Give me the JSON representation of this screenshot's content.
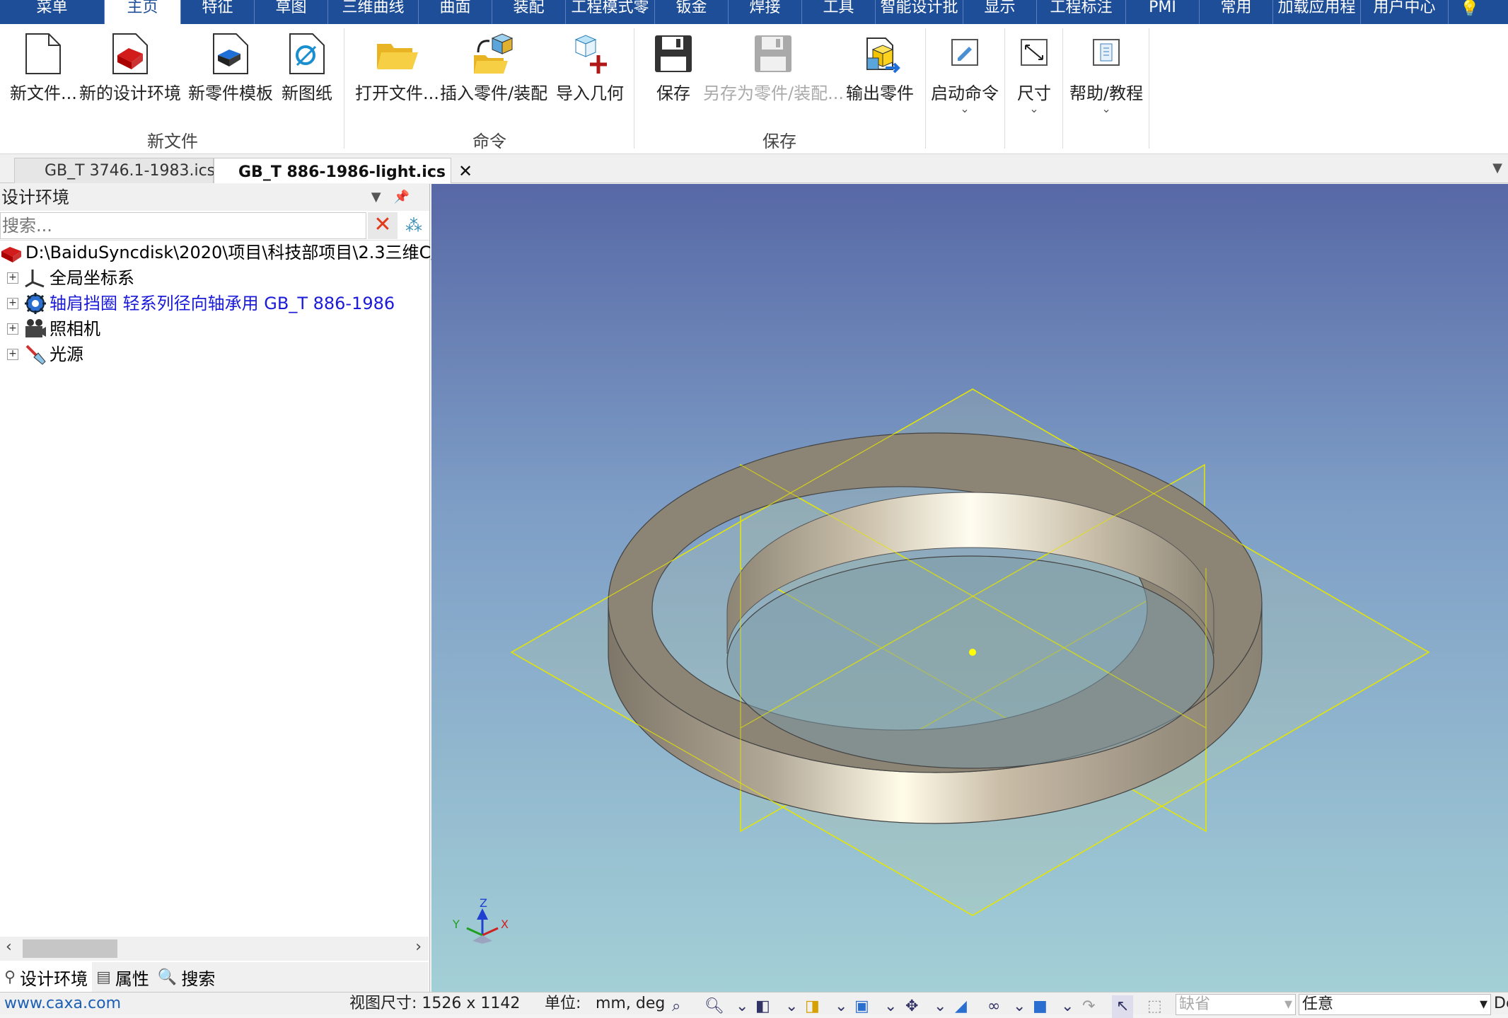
{
  "menubar": {
    "tabs": [
      "菜单",
      "主页",
      "特征",
      "草图",
      "三维曲线",
      "曲面",
      "装配",
      "工程模式零",
      "钣金",
      "焊接",
      "工具",
      "智能设计批",
      "显示",
      "工程标注",
      "PMI",
      "常用",
      "加载应用程",
      "用户中心"
    ],
    "active": "主页"
  },
  "ribbon": {
    "new_file": "新文件...",
    "new_design_env": "新的设计环境",
    "new_part_template": "新零件模板",
    "new_drawing": "新图纸",
    "open_file": "打开文件...",
    "insert_part": "插入零件/装配",
    "import_geometry": "导入几何",
    "save": "保存",
    "save_as_part": "另存为零件/装配...",
    "export_part": "输出零件",
    "start_command": "启动命令",
    "dimension": "尺寸",
    "help": "帮助/教程",
    "group_new": "新文件",
    "group_command": "命令",
    "group_save": "保存"
  },
  "docs": {
    "tab1": "GB_T 3746.1-1983.ics",
    "tab2": "GB_T 886-1986-light.ics",
    "close": "✕"
  },
  "panel": {
    "title": "设计环境",
    "search_placeholder": "搜索...",
    "tree": {
      "root": "D:\\BaiduSyncdisk\\2020\\项目\\科技部项目\\2.3三维C/",
      "items": [
        "全局坐标系",
        "轴肩挡圈 轻系列径向轴承用 GB_T 886-1986",
        "照相机",
        "光源"
      ]
    },
    "bottom_tabs": [
      "设计环境",
      "属性",
      "搜索"
    ]
  },
  "status": {
    "url": "www.caxa.com",
    "view_size": "视图尺寸: 1526 x 1142",
    "unit_label": "单位:",
    "unit_value": "mm, deg",
    "combo1": "缺省",
    "combo2": "任意",
    "trailing": "De"
  },
  "axis": {
    "x": "X",
    "y": "Y",
    "z": "Z"
  }
}
